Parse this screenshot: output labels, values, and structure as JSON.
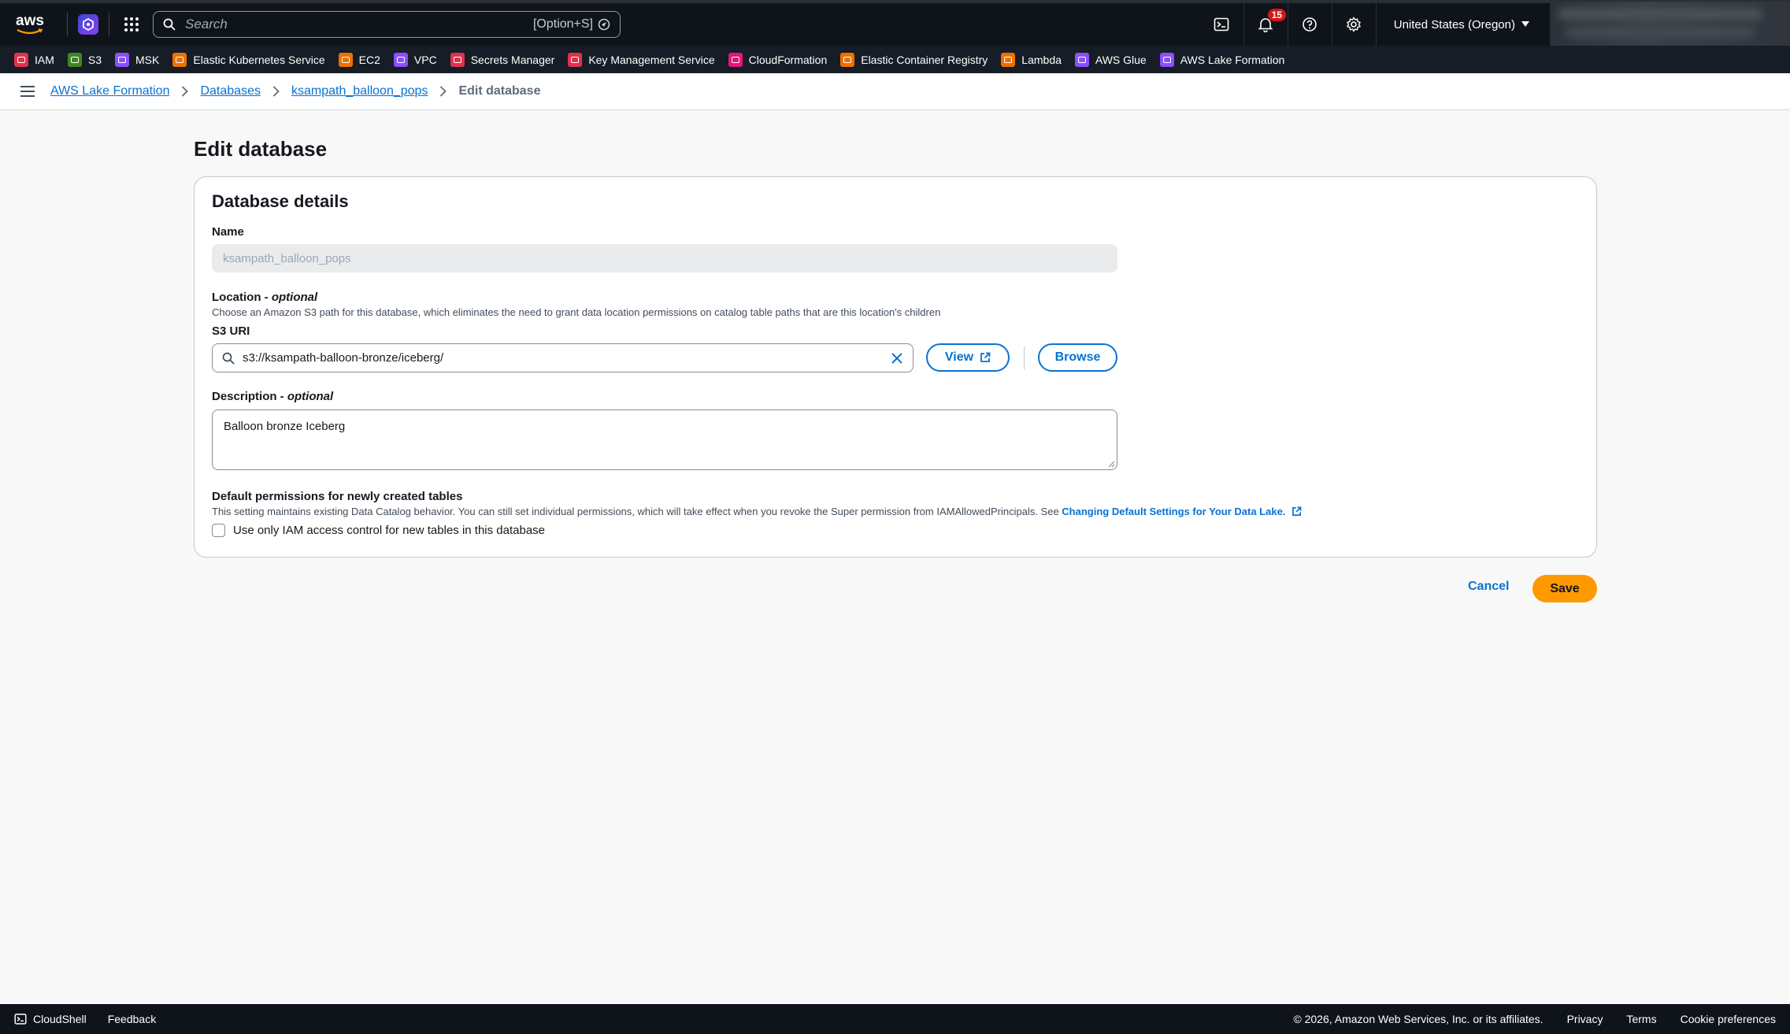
{
  "topnav": {
    "logo_text": "aws",
    "search_placeholder": "Search",
    "search_shortcut": "[Option+S]",
    "notification_count": "15",
    "region": "United States (Oregon)"
  },
  "favorites": [
    {
      "label": "IAM",
      "color": "#dd344c",
      "icon": "iam-icon"
    },
    {
      "label": "S3",
      "color": "#3f8624",
      "icon": "s3-icon"
    },
    {
      "label": "MSK",
      "color": "#8c4fff",
      "icon": "msk-icon"
    },
    {
      "label": "Elastic Kubernetes Service",
      "color": "#ed7100",
      "icon": "eks-icon"
    },
    {
      "label": "EC2",
      "color": "#ed7100",
      "icon": "ec2-icon"
    },
    {
      "label": "VPC",
      "color": "#8c4fff",
      "icon": "vpc-icon"
    },
    {
      "label": "Secrets Manager",
      "color": "#dd344c",
      "icon": "secrets-manager-icon"
    },
    {
      "label": "Key Management Service",
      "color": "#dd344c",
      "icon": "kms-icon"
    },
    {
      "label": "CloudFormation",
      "color": "#e7157b",
      "icon": "cloudformation-icon"
    },
    {
      "label": "Elastic Container Registry",
      "color": "#ed7100",
      "icon": "ecr-icon"
    },
    {
      "label": "Lambda",
      "color": "#ed7100",
      "icon": "lambda-icon"
    },
    {
      "label": "AWS Glue",
      "color": "#8c4fff",
      "icon": "glue-icon"
    },
    {
      "label": "AWS Lake Formation",
      "color": "#8c4fff",
      "icon": "lake-formation-icon"
    }
  ],
  "breadcrumb": {
    "items": [
      "AWS Lake Formation",
      "Databases",
      "ksampath_balloon_pops"
    ],
    "current": "Edit database"
  },
  "page": {
    "title": "Edit database",
    "section_title": "Database details",
    "name_label": "Name",
    "name_value": "ksampath_balloon_pops",
    "location_label": "Location - ",
    "location_optional": "optional",
    "location_hint": "Choose an Amazon S3 path for this database, which eliminates the need to grant data location permissions on catalog table paths that are this location's children",
    "s3_label": "S3 URI",
    "s3_value": "s3://ksampath-balloon-bronze/iceberg/",
    "view_label": "View",
    "browse_label": "Browse",
    "desc_label": "Description - ",
    "desc_optional": "optional",
    "desc_value": "Balloon bronze Iceberg",
    "perm_label": "Default permissions for newly created tables",
    "perm_hint": "This setting maintains existing Data Catalog behavior. You can still set individual permissions, which will take effect when you revoke the Super permission from IAMAllowedPrincipals. See ",
    "perm_link": "Changing Default Settings for Your Data Lake.",
    "checkbox_label": "Use only IAM access control for new tables in this database",
    "cancel_label": "Cancel",
    "save_label": "Save"
  },
  "footer": {
    "cloudshell": "CloudShell",
    "feedback": "Feedback",
    "copyright": "© 2026, Amazon Web Services, Inc. or its affiliates.",
    "privacy": "Privacy",
    "terms": "Terms",
    "cookies": "Cookie preferences"
  }
}
